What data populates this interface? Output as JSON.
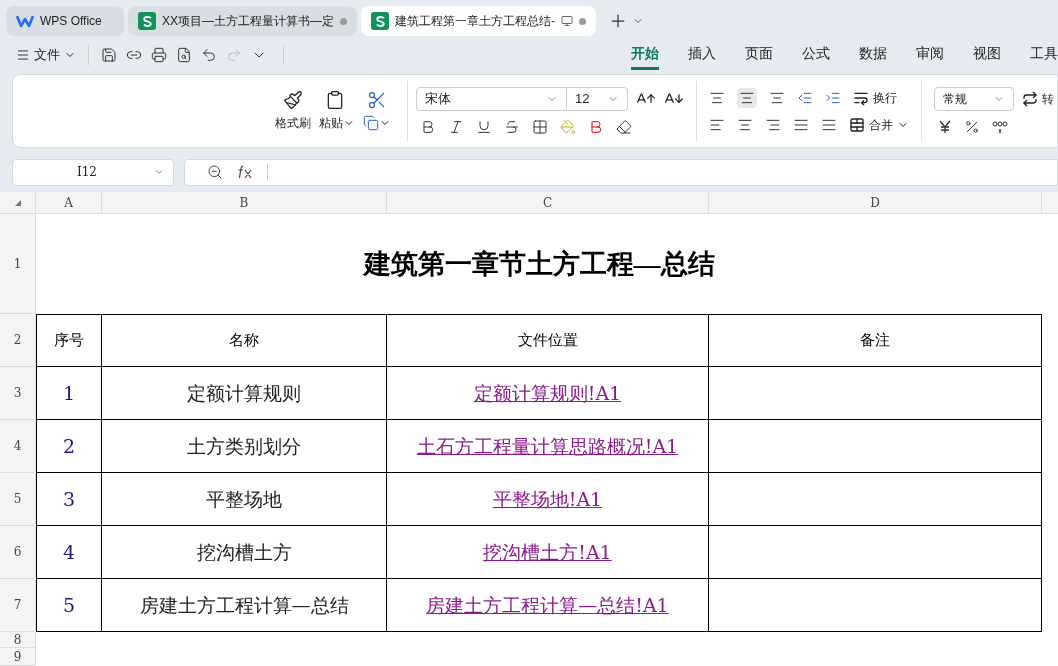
{
  "tabs": [
    {
      "kind": "home",
      "label": "WPS Office",
      "selected": false
    },
    {
      "kind": "sheet",
      "label": "XX项目—土方工程量计算书—定",
      "selected": false
    },
    {
      "kind": "sheet",
      "label": "建筑工程第一章土方工程总结-",
      "selected": true
    }
  ],
  "menu": {
    "file": "文件"
  },
  "ribbon_tabs": [
    {
      "label": "开始",
      "selected": true
    },
    {
      "label": "插入",
      "selected": false
    },
    {
      "label": "页面",
      "selected": false
    },
    {
      "label": "公式",
      "selected": false
    },
    {
      "label": "数据",
      "selected": false
    },
    {
      "label": "审阅",
      "selected": false
    },
    {
      "label": "视图",
      "selected": false
    },
    {
      "label": "工具",
      "selected": false
    }
  ],
  "ribbon": {
    "format_painter": "格式刷",
    "paste": "粘贴",
    "font": "宋体",
    "font_size": "12",
    "wrap": "换行",
    "merge": "合并",
    "number_format": "常规",
    "convert": "转"
  },
  "formula_bar": {
    "name_box": "I12"
  },
  "sheet": {
    "columns": [
      "A",
      "B",
      "C",
      "D"
    ],
    "rows": [
      "1",
      "2",
      "3",
      "4",
      "5",
      "6",
      "7",
      "8",
      "9"
    ],
    "title": "建筑第一章节土方工程—总结",
    "header": [
      "序号",
      "名称",
      "文件位置",
      "备注"
    ],
    "records": [
      {
        "no": "1",
        "name": "定额计算规则",
        "link": "定额计算规则!A1"
      },
      {
        "no": "2",
        "name": "土方类别划分",
        "link": "土石方工程量计算思路概况!A1"
      },
      {
        "no": "3",
        "name": "平整场地",
        "link": "平整场地!A1"
      },
      {
        "no": "4",
        "name": "挖沟槽土方",
        "link": "挖沟槽土方!A1"
      },
      {
        "no": "5",
        "name": "房建土方工程计算—总结",
        "link": "房建土方工程计算—总结!A1"
      }
    ]
  }
}
